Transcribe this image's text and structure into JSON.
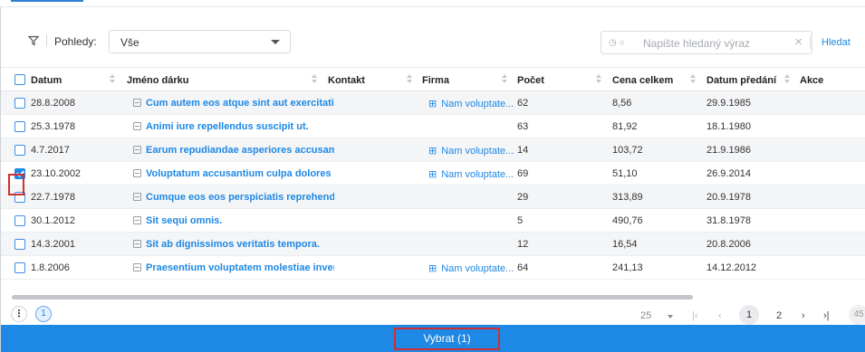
{
  "toolbar": {
    "views_label": "Pohledy:",
    "view_selected": "Vše",
    "search_placeholder": "Napište hledaný výraz",
    "search_button": "Hledat",
    "clear_glyph": "×"
  },
  "columns": [
    "Datum",
    "Jméno dárku",
    "Kontakt",
    "Firma",
    "Počet",
    "Cena celkem",
    "Datum předání",
    "Akce"
  ],
  "rows": [
    {
      "datum": "28.8.2008",
      "gift": "Cum autem eos atque sint aut exercitation",
      "firma": "Nam voluptate...",
      "pocet": "62",
      "cena": "8,56",
      "predani": "29.9.1985",
      "checked": false
    },
    {
      "datum": "25.3.1978",
      "gift": "Animi iure repellendus suscipit ut.",
      "firma": "",
      "pocet": "63",
      "cena": "81,92",
      "predani": "18.1.1980",
      "checked": false
    },
    {
      "datum": "4.7.2017",
      "gift": "Earum repudiandae asperiores accusamus.",
      "firma": "Nam voluptate...",
      "pocet": "14",
      "cena": "103,72",
      "predani": "21.9.1986",
      "checked": false
    },
    {
      "datum": "23.10.2002",
      "gift": "Voluptatum accusantium culpa dolores nei",
      "firma": "Nam voluptate...",
      "pocet": "69",
      "cena": "51,10",
      "predani": "26.9.2014",
      "checked": true
    },
    {
      "datum": "22.7.1978",
      "gift": "Cumque eos eos perspiciatis reprehenderit",
      "firma": "",
      "pocet": "29",
      "cena": "313,89",
      "predani": "20.9.1978",
      "checked": false
    },
    {
      "datum": "30.1.2012",
      "gift": "Sit sequi omnis.",
      "firma": "",
      "pocet": "5",
      "cena": "490,76",
      "predani": "31.8.1978",
      "checked": false
    },
    {
      "datum": "14.3.2001",
      "gift": "Sit ab dignissimos veritatis tempora.",
      "firma": "",
      "pocet": "12",
      "cena": "16,54",
      "predani": "20.8.2006",
      "checked": false
    },
    {
      "datum": "1.8.2006",
      "gift": "Praesentium voluptatem molestiae invent",
      "firma": "Nam voluptate...",
      "pocet": "64",
      "cena": "241,13",
      "predani": "14.12.2012",
      "checked": false
    }
  ],
  "pager": {
    "dots": "⋮",
    "selected_count": "1",
    "page_size": "25",
    "first": "|‹",
    "prev": "‹",
    "current": "1",
    "next_page": "2",
    "next": "›",
    "last": "›|",
    "more": "45"
  },
  "select_button": "Vybrat (1)",
  "colors": {
    "accent": "#1e88e5",
    "highlight": "#d32f2f"
  }
}
